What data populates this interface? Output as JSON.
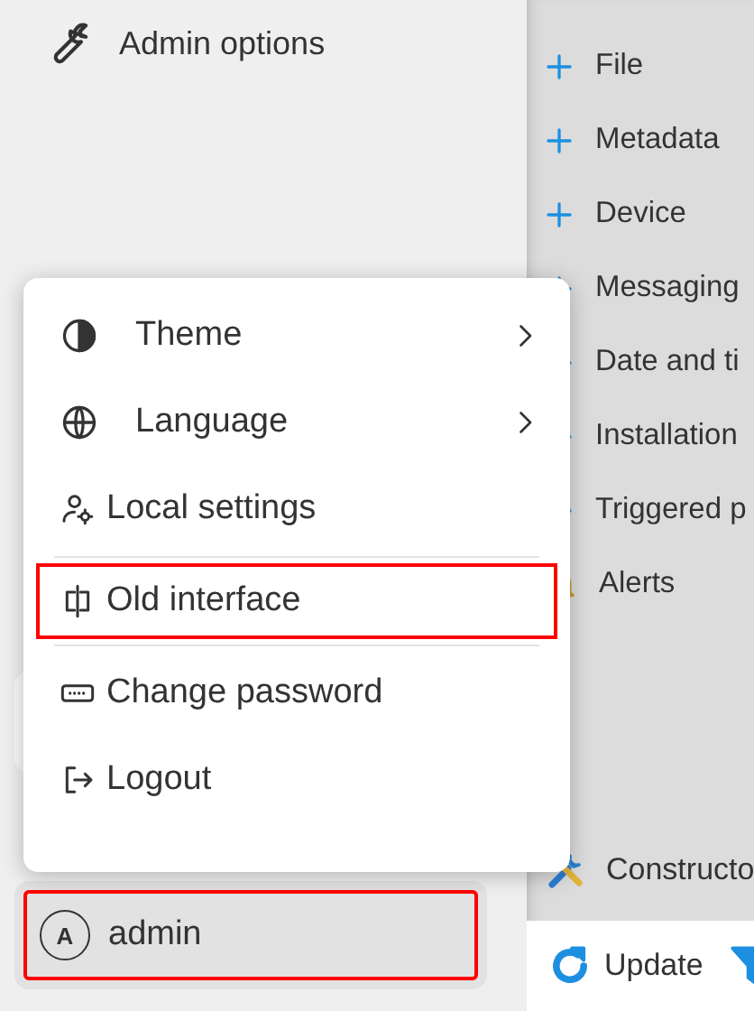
{
  "sidebar": {
    "admin_options": {
      "label": "Admin options"
    },
    "user": {
      "avatar": "A",
      "name": "admin",
      "highlighted": true
    }
  },
  "nav": {
    "items": [
      {
        "label": "File",
        "kind": "plus"
      },
      {
        "label": "Metadata",
        "kind": "plus"
      },
      {
        "label": "Device",
        "kind": "plus"
      },
      {
        "label": "Messaging",
        "kind": "plus"
      },
      {
        "label": "Date and ti",
        "kind": "plus"
      },
      {
        "label": "Installation",
        "kind": "plus"
      },
      {
        "label": "Triggered p",
        "kind": "plus"
      },
      {
        "label": "Alerts",
        "kind": "bell"
      }
    ],
    "bottom_item": {
      "label": "Constructo",
      "kind": "tools"
    }
  },
  "toolbar": {
    "buttons": [
      {
        "label": "Update",
        "kind": "refresh"
      },
      {
        "kind": "filter"
      }
    ]
  },
  "menu": {
    "sections": [
      [
        {
          "kind": "theme",
          "label": "Theme",
          "submenu": true,
          "highlighted": false
        },
        {
          "kind": "globe",
          "label": "Language",
          "submenu": true,
          "highlighted": false
        },
        {
          "kind": "user-gear",
          "label": "Local settings",
          "submenu": false,
          "highlighted": false
        }
      ],
      [
        {
          "kind": "split",
          "label": "Old interface",
          "submenu": false,
          "highlighted": true
        }
      ],
      [
        {
          "kind": "password",
          "label": "Change password",
          "submenu": false,
          "highlighted": false
        },
        {
          "kind": "logout",
          "label": "Logout",
          "submenu": false,
          "highlighted": false
        }
      ]
    ]
  }
}
